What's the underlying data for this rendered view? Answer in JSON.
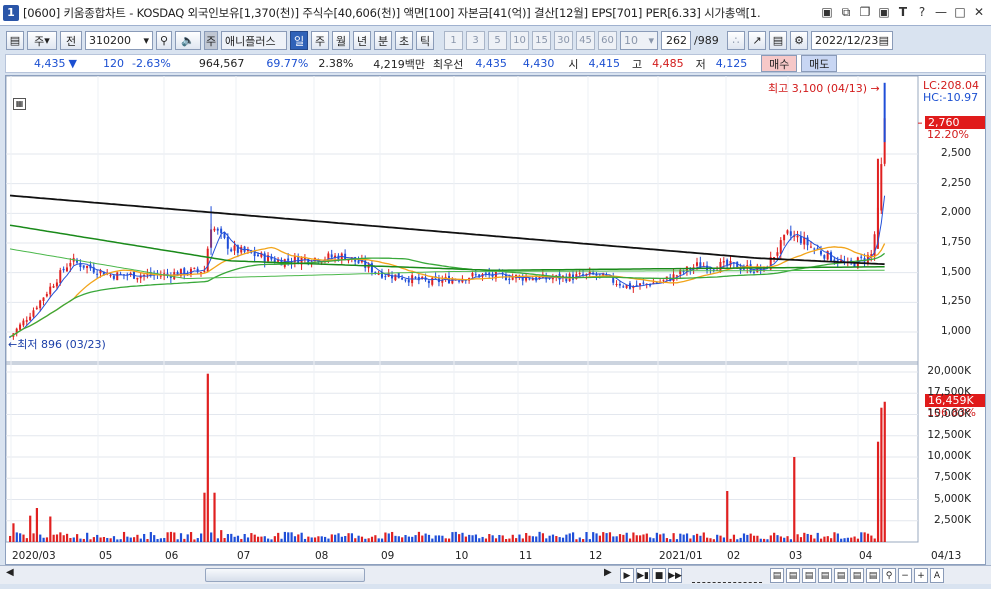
{
  "window": {
    "number": "1",
    "title": "[0600] 키움종합차트 - KOSDAQ 외국인보유[1,370(천)] 주식수[40,606(천)] 액면[100] 자본금[41(억)] 결산[12월] EPS[701] PER[6.33] 시가총액[1."
  },
  "toolbar": {
    "market_label": "주",
    "prev_label": "전",
    "stock_code": "310200",
    "stock_name": "애니플러스",
    "stock_badge": "주",
    "periods": [
      "일",
      "주",
      "월",
      "년",
      "분",
      "초",
      "틱"
    ],
    "active_period": "일",
    "intervals": [
      "1",
      "3",
      "5",
      "10",
      "15",
      "30",
      "45",
      "60"
    ],
    "interval_value": "10",
    "count": "262",
    "total": "/989",
    "date": "2022/12/23"
  },
  "quote": {
    "price": "4,435",
    "change": "120",
    "change_rate": "-2.63%",
    "volume": "964,567",
    "ratio": "69.77%",
    "turnover": "2.38%",
    "amount": "4,219백만",
    "best_label": "최우선",
    "bid": "4,435",
    "ask": "4,430",
    "open_label": "시",
    "open": "4,415",
    "high_label": "고",
    "high": "4,485",
    "low_label": "저",
    "low": "4,125",
    "buy_label": "매수",
    "sell_label": "매도"
  },
  "chart_annotations": {
    "high_note": "최고 3,100 (04/13)",
    "low_note": "최저 896 (03/23)",
    "lc": "LC:208.04",
    "hc": "HC:-10.97",
    "current_price": "2,760",
    "current_pct": "12.20%",
    "current_volume": "16,459K",
    "volume_pct": "106.83%"
  },
  "price_axis": [
    "2,500",
    "2,250",
    "2,000",
    "1,750",
    "1,500",
    "1,250",
    "1,000"
  ],
  "volume_axis": [
    "20,000K",
    "17,500K",
    "15,000K",
    "12,500K",
    "10,000K",
    "7,500K",
    "5,000K",
    "2,500K"
  ],
  "x_axis": [
    "2020/03",
    "05",
    "06",
    "07",
    "08",
    "09",
    "10",
    "11",
    "12",
    "2021/01",
    "02",
    "03",
    "04",
    "04/13"
  ],
  "colors": {
    "up": "#e02020",
    "down": "#1f4ed8",
    "ma5": "#2552d9",
    "ma20": "#f2a41a",
    "ma60": "#39a83a",
    "ma120": "#1a8a1a",
    "ma240": "#111111"
  }
}
